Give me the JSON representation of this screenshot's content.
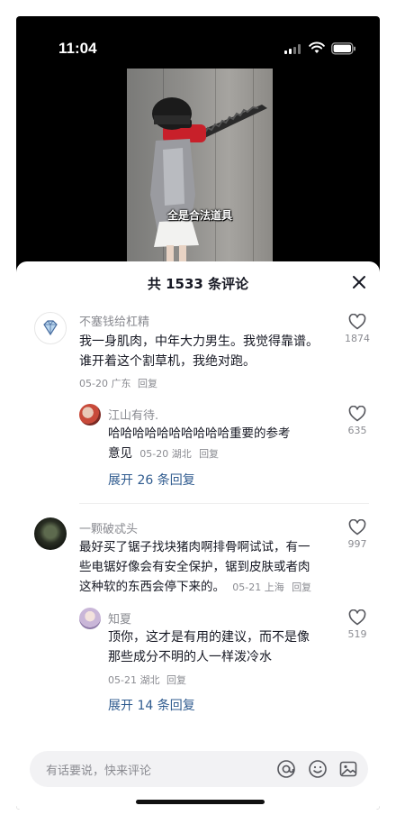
{
  "status_bar": {
    "time": "11:04",
    "icons": [
      "signal-icon",
      "wifi-icon",
      "battery-icon"
    ]
  },
  "video": {
    "caption": "全是合法道具"
  },
  "sheet": {
    "title": "共 1533 条评论",
    "close_icon": "close-icon"
  },
  "comments": [
    {
      "user": "不塞钱给杠精",
      "text_lines": [
        "我一身肌肉，中年大力男生。我觉得靠谱。",
        "谁开着这个割草机，我绝对跑。"
      ],
      "meta": "05-20 广东",
      "reply": "回复",
      "likes": "1874",
      "replies": [
        {
          "user": "江山有待.",
          "text_lines": [
            "哈哈哈哈哈哈哈哈哈哈重要的参考",
            "意见"
          ],
          "meta": "05-20 湖北",
          "reply": "回复",
          "likes": "635"
        }
      ],
      "expand": "展开 26 条回复"
    },
    {
      "user": "一颗破忒头",
      "text_lines": [
        "最好买了锯子找块猪肉啊排骨啊试试，有一",
        "些电锯好像会有安全保护，锯到皮肤或者肉",
        "这种软的东西会停下来的。"
      ],
      "meta": "05-21 上海",
      "reply": "回复",
      "likes": "997",
      "replies": [
        {
          "user": "知夏",
          "text_lines": [
            "顶你，这才是有用的建议，而不是像",
            "那些成分不明的人一样泼冷水"
          ],
          "meta": "05-21 湖北",
          "reply": "回复",
          "likes": "519"
        }
      ],
      "expand": "展开 14 条回复"
    }
  ],
  "input": {
    "placeholder": "有话要说，快来评论",
    "icons": [
      "at-icon",
      "emoji-icon",
      "image-icon"
    ]
  },
  "colors": {
    "link": "#2f5b8f",
    "muted": "#8a8b91",
    "text": "#161823"
  }
}
